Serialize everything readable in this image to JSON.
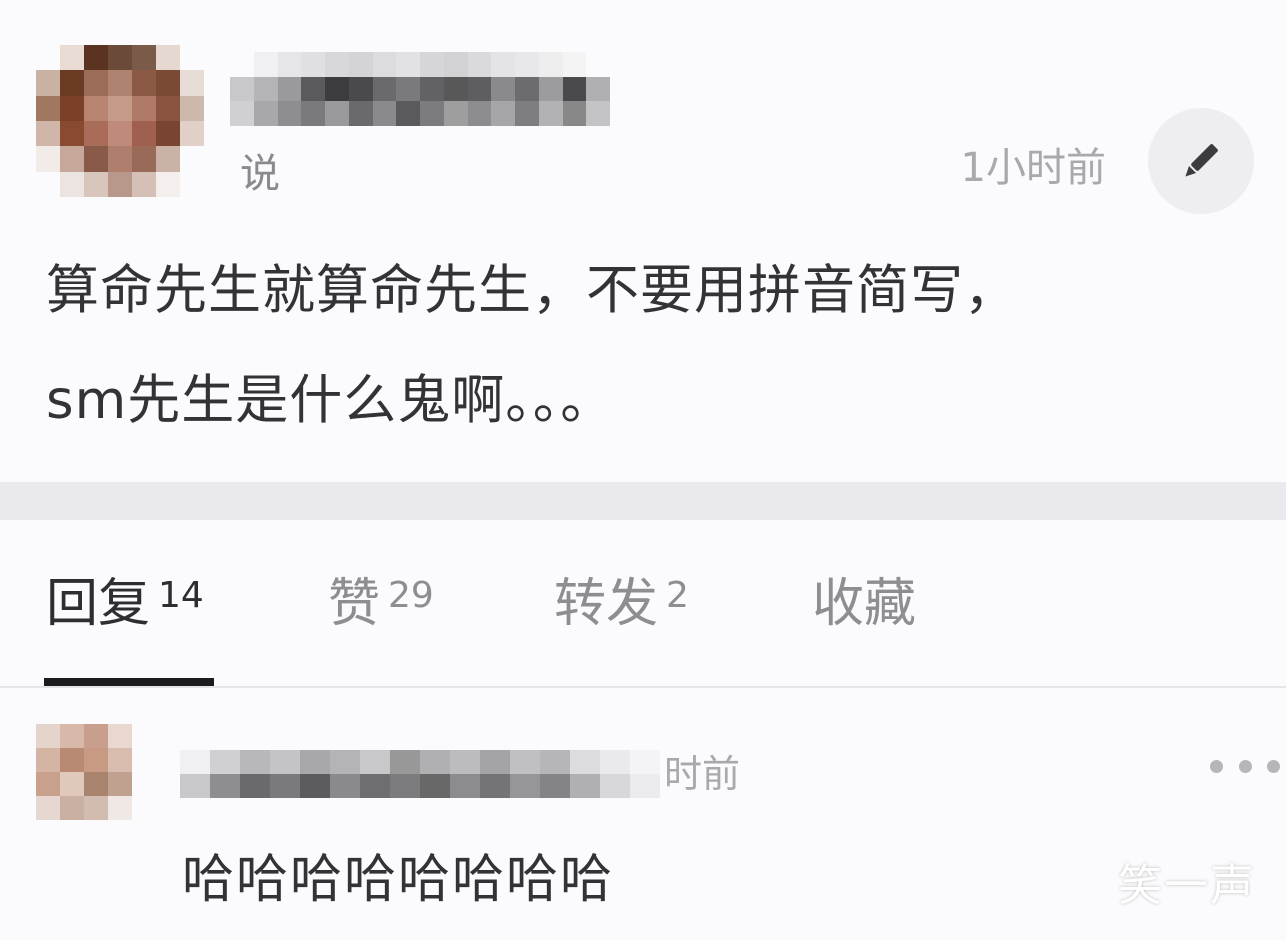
{
  "post": {
    "said_label": "说",
    "time": "1小时前",
    "text_line1": "算命先生就算命先生，不要用拼音简写，",
    "text_line2": "sm先生是什么鬼啊。。。"
  },
  "icons": {
    "edit": "pencil-icon",
    "more": "more-horizontal-icon"
  },
  "tabs": [
    {
      "label": "回复",
      "count": "14",
      "active": true
    },
    {
      "label": "赞",
      "count": "29",
      "active": false
    },
    {
      "label": "转发",
      "count": "2",
      "active": false
    },
    {
      "label": "收藏",
      "count": "",
      "active": false
    }
  ],
  "reply": {
    "time": "时前",
    "text": "哈哈哈哈哈哈哈哈"
  },
  "watermark": "笑一声",
  "colors": {
    "background": "#fbfafc",
    "divider_band": "#eae9ed",
    "text_primary": "#333337",
    "text_secondary": "#8e8e92",
    "active_tab_underline": "#1c1c1e"
  }
}
